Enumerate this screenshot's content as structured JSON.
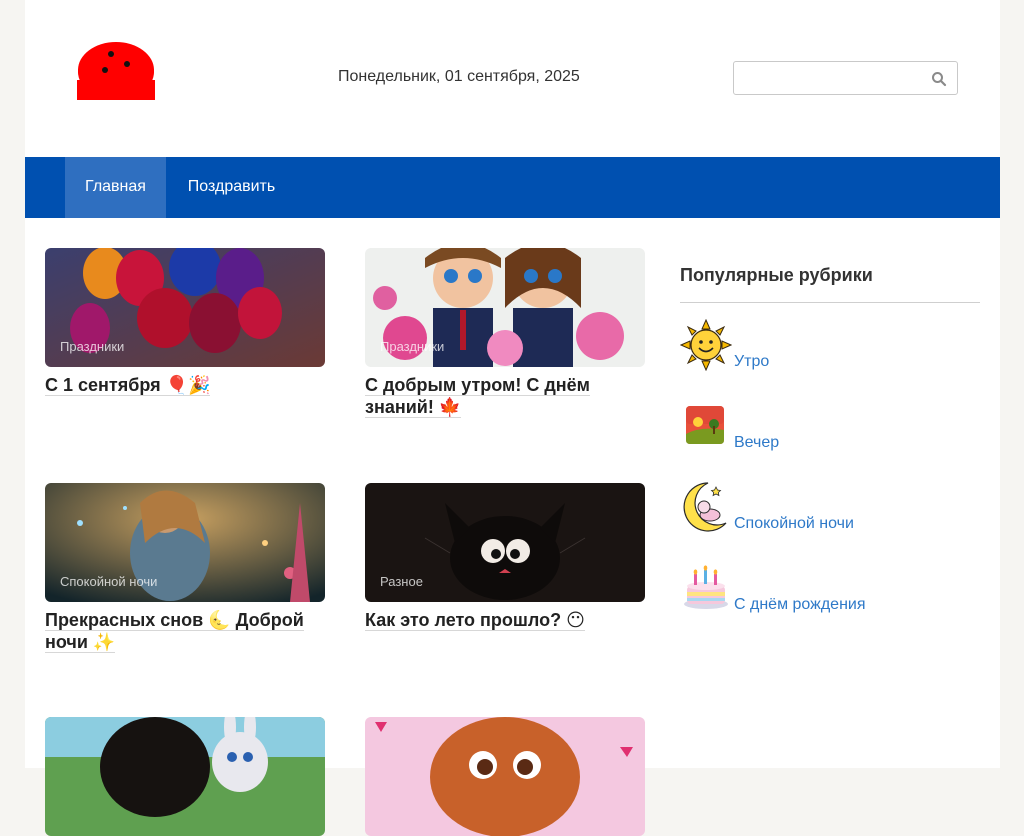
{
  "header": {
    "date": "Понедельник, 01 сентября, 2025",
    "search": {
      "placeholder": "",
      "value": ""
    }
  },
  "nav": {
    "items": [
      {
        "label": "Главная",
        "active": true
      },
      {
        "label": "Поздравить",
        "active": false
      }
    ]
  },
  "posts": [
    {
      "category": "Праздники",
      "title": "С 1 сентября 🎈🎉"
    },
    {
      "category": "Праздники",
      "title": "С добрым утром! С днём знаний! 🍁"
    },
    {
      "category": "Спокойной ночи",
      "title": "Прекрасных снов 🌜 Доброй ночи ✨"
    },
    {
      "category": "Разное",
      "title": "Как это лето прошло? 😶"
    },
    {
      "category": "",
      "title": ""
    },
    {
      "category": "",
      "title": ""
    }
  ],
  "sidebar": {
    "heading": "Популярные рубрики",
    "items": [
      {
        "label": "Утро",
        "icon": "sun-icon"
      },
      {
        "label": "Вечер",
        "icon": "sunset-icon"
      },
      {
        "label": "Спокойной ночи",
        "icon": "moon-icon"
      },
      {
        "label": "С днём рождения",
        "icon": "cake-icon"
      }
    ]
  },
  "colors": {
    "nav_bg": "#0050b0",
    "nav_active": "#2f6fc0",
    "link": "#2e79c8",
    "logo": "#ff0000"
  }
}
